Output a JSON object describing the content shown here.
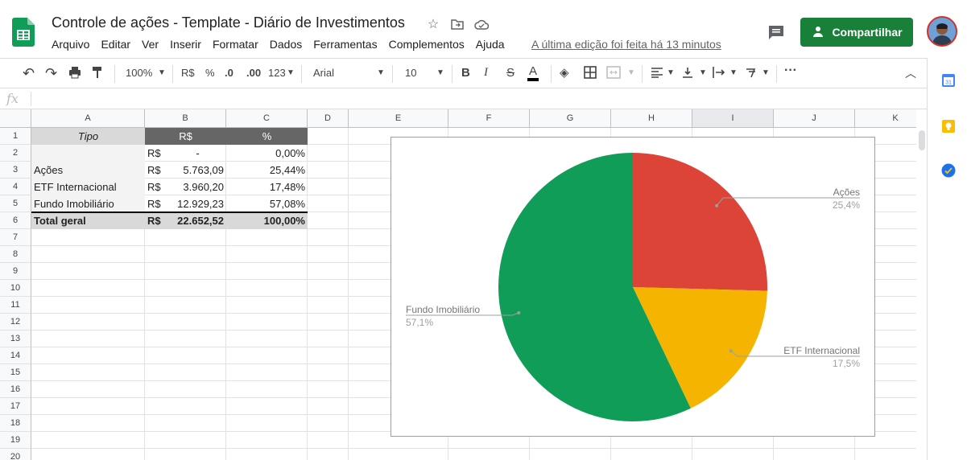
{
  "app": {
    "title": "Controle de ações - Template - Diário de Investimentos",
    "menus": [
      "Arquivo",
      "Editar",
      "Ver",
      "Inserir",
      "Formatar",
      "Dados",
      "Ferramentas",
      "Complementos",
      "Ajuda"
    ],
    "last_edit": "A última edição foi feita há 13 minutos",
    "share_label": "Compartilhar"
  },
  "toolbar": {
    "zoom": "100%",
    "currency": "R$",
    "percent": "%",
    "dec_less": ".0",
    "dec_more": ".00",
    "number_format": "123",
    "font": "Arial",
    "font_size": "10",
    "bold": "B",
    "italic": "I",
    "strike": "S",
    "text_color": "A"
  },
  "formula_bar": {
    "fx": "fx",
    "value": ""
  },
  "columns": [
    "A",
    "B",
    "C",
    "D",
    "E",
    "F",
    "G",
    "H",
    "I",
    "J",
    "K"
  ],
  "rows": [
    "1",
    "2",
    "3",
    "4",
    "5",
    "6",
    "7",
    "8",
    "9",
    "10",
    "11",
    "12",
    "13",
    "14",
    "15",
    "16",
    "17",
    "18",
    "19",
    "20"
  ],
  "table": {
    "header": {
      "tipo": "Tipo",
      "rs": "R$",
      "pct": "%"
    },
    "body": [
      {
        "tipo": "",
        "cur": "R$",
        "val": "-",
        "pct": "0,00%"
      },
      {
        "tipo": "Ações",
        "cur": "R$",
        "val": "5.763,09",
        "pct": "25,44%"
      },
      {
        "tipo": "ETF Internacional",
        "cur": "R$",
        "val": "3.960,20",
        "pct": "17,48%"
      },
      {
        "tipo": "Fundo Imobiliário",
        "cur": "R$",
        "val": "12.929,23",
        "pct": "57,08%"
      }
    ],
    "total": {
      "tipo": "Total geral",
      "cur": "R$",
      "val": "22.652,52",
      "pct": "100,00%"
    }
  },
  "chart_data": {
    "type": "pie",
    "slices": [
      {
        "label": "Ações",
        "pct_label": "25,4%",
        "value": 25.44,
        "color": "#db4437"
      },
      {
        "label": "ETF Internacional",
        "pct_label": "17,5%",
        "value": 17.48,
        "color": "#f4b400"
      },
      {
        "label": "Fundo Imobiliário",
        "pct_label": "57,1%",
        "value": 57.08,
        "color": "#0f9d58"
      }
    ]
  },
  "colors": {
    "share": "#188038",
    "header_dark": "#666666",
    "header_light": "#d9d9d9"
  }
}
